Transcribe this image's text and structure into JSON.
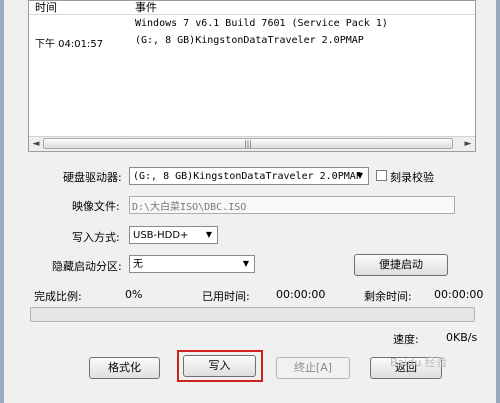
{
  "log": {
    "columns": [
      "时间",
      "事件"
    ],
    "rows": [
      {
        "time": "",
        "event": "Windows 7 v6.1 Build 7601 (Service Pack 1)"
      },
      {
        "time": "下午 04:01:57",
        "event": "(G:, 8 GB)KingstonDataTraveler 2.0PMAP"
      }
    ],
    "scroll_left": "◄",
    "scroll_right": "►",
    "scroll_grip": "|||"
  },
  "form": {
    "drive_label": "硬盘驱动器:",
    "drive_value": "(G:, 8 GB)KingstonDataTraveler 2.0PMAP",
    "verify_label": "刻录校验",
    "image_label": "映像文件:",
    "image_value": "D:\\大白菜ISO\\DBC.ISO",
    "write_mode_label": "写入方式:",
    "write_mode_value": "USB-HDD+",
    "hidden_partition_label": "隐藏启动分区:",
    "hidden_partition_value": "无",
    "quick_boot_label": "便捷启动",
    "dropdown_arrow": "▼"
  },
  "status": {
    "completion_label": "完成比例:",
    "completion_value": "0%",
    "elapsed_label": "已用时间:",
    "elapsed_value": "00:00:00",
    "remaining_label": "剩余时间:",
    "remaining_value": "00:00:00",
    "progress": 0,
    "speed_label": "速度:",
    "speed_value": "0KB/s"
  },
  "buttons": {
    "format": "格式化",
    "write": "写入",
    "abort": "终止[A]",
    "back": "返回"
  },
  "watermark": "Baidu 经验",
  "colors": {
    "highlight": "#d02020",
    "progress_fill": "#3cb043"
  }
}
